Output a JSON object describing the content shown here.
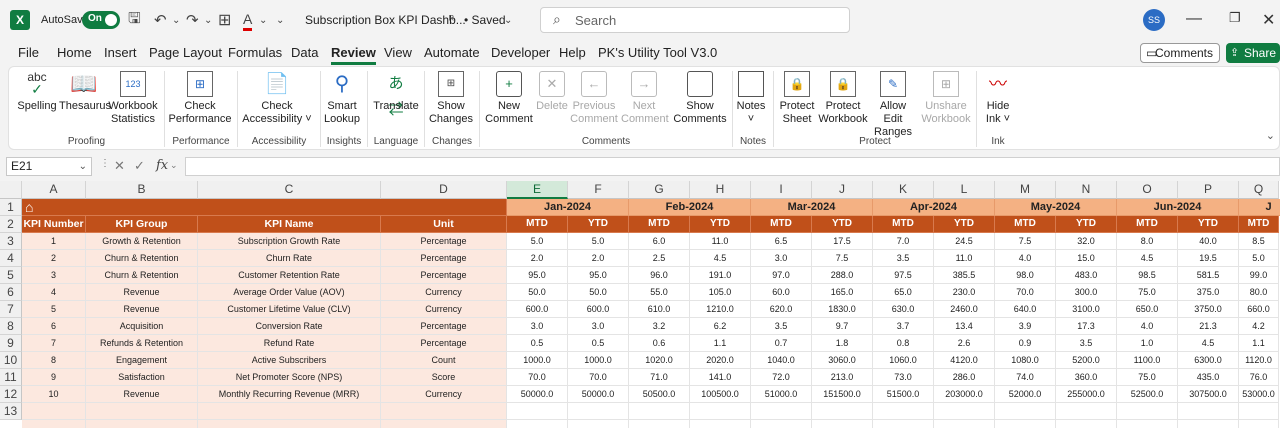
{
  "titlebar": {
    "autosave_label": "AutoSave",
    "toggle_label": "On",
    "doc_title": "Subscription Box KPI Dashb...",
    "saved_status": "• Saved",
    "search_placeholder": "Search",
    "user_initials": "SS"
  },
  "menu": {
    "items": [
      "File",
      "Home",
      "Insert",
      "Page Layout",
      "Formulas",
      "Data",
      "Review",
      "View",
      "Automate",
      "Developer",
      "Help",
      "PK's Utility Tool V3.0"
    ],
    "active": "Review",
    "comments_btn": "Comments",
    "share_btn": "Share"
  },
  "ribbon": {
    "buttons": [
      {
        "label": "Spelling",
        "icon": "spelling-icon",
        "enabled": true
      },
      {
        "label": "Thesaurus",
        "icon": "thesaurus-icon",
        "enabled": true
      },
      {
        "label": "Workbook Statistics",
        "icon": "workbook-statistics-icon",
        "enabled": true
      },
      {
        "label": "Check Performance",
        "icon": "check-performance-icon",
        "enabled": true
      },
      {
        "label": "Check Accessibility ˅",
        "icon": "accessibility-icon",
        "enabled": true
      },
      {
        "label": "Smart Lookup",
        "icon": "smart-lookup-icon",
        "enabled": true
      },
      {
        "label": "Translate",
        "icon": "translate-icon",
        "enabled": true
      },
      {
        "label": "Show Changes",
        "icon": "show-changes-icon",
        "enabled": true
      },
      {
        "label": "New Comment",
        "icon": "new-comment-icon",
        "enabled": true
      },
      {
        "label": "Delete",
        "icon": "delete-comment-icon",
        "enabled": false
      },
      {
        "label": "Previous Comment",
        "icon": "previous-comment-icon",
        "enabled": false
      },
      {
        "label": "Next Comment",
        "icon": "next-comment-icon",
        "enabled": false
      },
      {
        "label": "Show Comments",
        "icon": "show-comments-icon",
        "enabled": true
      },
      {
        "label": "Notes ˅",
        "icon": "notes-icon",
        "enabled": true
      },
      {
        "label": "Protect Sheet",
        "icon": "protect-sheet-icon",
        "enabled": true
      },
      {
        "label": "Protect Workbook",
        "icon": "protect-workbook-icon",
        "enabled": true
      },
      {
        "label": "Allow Edit Ranges",
        "icon": "allow-edit-ranges-icon",
        "enabled": true
      },
      {
        "label": "Unshare Workbook",
        "icon": "unshare-workbook-icon",
        "enabled": false
      },
      {
        "label": "Hide Ink ˅",
        "icon": "hide-ink-icon",
        "enabled": true
      }
    ],
    "groups": [
      "Proofing",
      "Performance",
      "Accessibility",
      "Insights",
      "Language",
      "Changes",
      "Comments",
      "Notes",
      "Protect",
      "Ink"
    ]
  },
  "formula_bar": {
    "name_box": "E21",
    "fx_label": "fx",
    "formula": ""
  },
  "sheet": {
    "columns": [
      "A",
      "B",
      "C",
      "D",
      "E",
      "F",
      "G",
      "H",
      "I",
      "J",
      "K",
      "L",
      "M",
      "N",
      "O",
      "P",
      "Q"
    ],
    "selected_column": "E",
    "rows": [
      "1",
      "2",
      "3",
      "4",
      "5",
      "6",
      "7",
      "8",
      "9",
      "10",
      "11",
      "12",
      "13"
    ],
    "home_icon": "home-icon",
    "headers": [
      "KPI Number",
      "KPI Group",
      "KPI Name",
      "Unit"
    ],
    "months": [
      "Jan-2024",
      "Feb-2024",
      "Mar-2024",
      "Apr-2024",
      "May-2024",
      "Jun-2024",
      "J"
    ],
    "sub_headers": [
      "MTD",
      "YTD"
    ],
    "kpis": [
      {
        "num": "1",
        "group": "Growth & Retention",
        "name": "Subscription Growth Rate",
        "unit": "Percentage",
        "values": [
          "5.0",
          "5.0",
          "6.0",
          "11.0",
          "6.5",
          "17.5",
          "7.0",
          "24.5",
          "7.5",
          "32.0",
          "8.0",
          "40.0",
          "8.5"
        ]
      },
      {
        "num": "2",
        "group": "Churn & Retention",
        "name": "Churn Rate",
        "unit": "Percentage",
        "values": [
          "2.0",
          "2.0",
          "2.5",
          "4.5",
          "3.0",
          "7.5",
          "3.5",
          "11.0",
          "4.0",
          "15.0",
          "4.5",
          "19.5",
          "5.0"
        ]
      },
      {
        "num": "3",
        "group": "Churn & Retention",
        "name": "Customer Retention Rate",
        "unit": "Percentage",
        "values": [
          "95.0",
          "95.0",
          "96.0",
          "191.0",
          "97.0",
          "288.0",
          "97.5",
          "385.5",
          "98.0",
          "483.0",
          "98.5",
          "581.5",
          "99.0"
        ]
      },
      {
        "num": "4",
        "group": "Revenue",
        "name": "Average Order Value (AOV)",
        "unit": "Currency",
        "values": [
          "50.0",
          "50.0",
          "55.0",
          "105.0",
          "60.0",
          "165.0",
          "65.0",
          "230.0",
          "70.0",
          "300.0",
          "75.0",
          "375.0",
          "80.0"
        ]
      },
      {
        "num": "5",
        "group": "Revenue",
        "name": "Customer Lifetime Value (CLV)",
        "unit": "Currency",
        "values": [
          "600.0",
          "600.0",
          "610.0",
          "1210.0",
          "620.0",
          "1830.0",
          "630.0",
          "2460.0",
          "640.0",
          "3100.0",
          "650.0",
          "3750.0",
          "660.0"
        ]
      },
      {
        "num": "6",
        "group": "Acquisition",
        "name": "Conversion Rate",
        "unit": "Percentage",
        "values": [
          "3.0",
          "3.0",
          "3.2",
          "6.2",
          "3.5",
          "9.7",
          "3.7",
          "13.4",
          "3.9",
          "17.3",
          "4.0",
          "21.3",
          "4.2"
        ]
      },
      {
        "num": "7",
        "group": "Refunds & Retention",
        "name": "Refund Rate",
        "unit": "Percentage",
        "values": [
          "0.5",
          "0.5",
          "0.6",
          "1.1",
          "0.7",
          "1.8",
          "0.8",
          "2.6",
          "0.9",
          "3.5",
          "1.0",
          "4.5",
          "1.1"
        ]
      },
      {
        "num": "8",
        "group": "Engagement",
        "name": "Active Subscribers",
        "unit": "Count",
        "values": [
          "1000.0",
          "1000.0",
          "1020.0",
          "2020.0",
          "1040.0",
          "3060.0",
          "1060.0",
          "4120.0",
          "1080.0",
          "5200.0",
          "1100.0",
          "6300.0",
          "1120.0"
        ]
      },
      {
        "num": "9",
        "group": "Satisfaction",
        "name": "Net Promoter Score (NPS)",
        "unit": "Score",
        "values": [
          "70.0",
          "70.0",
          "71.0",
          "141.0",
          "72.0",
          "213.0",
          "73.0",
          "286.0",
          "74.0",
          "360.0",
          "75.0",
          "435.0",
          "76.0"
        ]
      },
      {
        "num": "10",
        "group": "Revenue",
        "name": "Monthly Recurring Revenue (MRR)",
        "unit": "Currency",
        "values": [
          "50000.0",
          "50000.0",
          "50500.0",
          "100500.0",
          "51000.0",
          "151500.0",
          "51500.0",
          "203000.0",
          "52000.0",
          "255000.0",
          "52500.0",
          "307500.0",
          "53000.0"
        ]
      }
    ]
  }
}
